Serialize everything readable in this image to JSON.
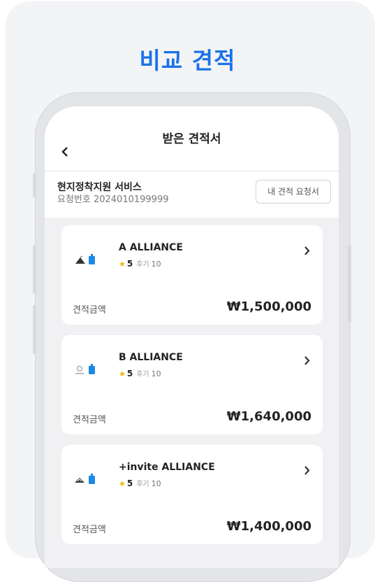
{
  "headline": "비교 견적",
  "screen": {
    "title": "받은 견적서",
    "service_name": "현지정착지원 서비스",
    "request_number": "요청번호 2024010199999",
    "my_request_button": "내 견적 요청서"
  },
  "quotes": [
    {
      "company": "A ALLIANCE",
      "rating": "5",
      "review_label": "후기",
      "review_count": "10",
      "price_label": "견적금액",
      "price": "₩1,500,000"
    },
    {
      "company": "B ALLIANCE",
      "rating": "5",
      "review_label": "후기",
      "review_count": "10",
      "price_label": "견적금액",
      "price": "₩1,640,000"
    },
    {
      "company": "+invite ALLIANCE",
      "rating": "5",
      "review_label": "후기",
      "review_count": "10",
      "price_label": "견적금액",
      "price": "₩1,400,000"
    }
  ],
  "colors": {
    "accent": "#1a73e8",
    "star": "#f4b400",
    "logo_blue": "#1e88e5"
  },
  "icons": {
    "back": "chevron-left-icon",
    "open": "chevron-right-icon",
    "rating": "star-icon"
  }
}
